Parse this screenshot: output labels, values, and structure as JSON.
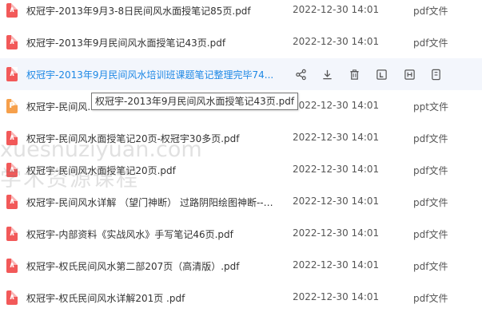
{
  "files": [
    {
      "name": "权冠宇-2013年9月3-8日民间风水面授笔记85页.pdf",
      "date": "2022-12-30 14:01",
      "type": "pdf文件",
      "icon": "pdf-file-icon",
      "hover": false
    },
    {
      "name": "权冠宇-2013年9月民间风水面授笔记43页.pdf",
      "date": "2022-12-30 14:01",
      "type": "pdf文件",
      "icon": "pdf-file-icon",
      "hover": false
    },
    {
      "name": "权冠宇-2013年9月民间风水培训班课题笔记整理完毕74...",
      "date": "",
      "type": "",
      "icon": "pdf-file-icon",
      "hover": true
    },
    {
      "name": "权冠宇-民间风...",
      "date": "2022-12-30 14:01",
      "type": "ppt文件",
      "icon": "ppt-file-icon",
      "hover": false
    },
    {
      "name": "权冠宇-民间风水面授笔记20页-权冠宇30多页.pdf",
      "date": "2022-12-30 14:01",
      "type": "pdf文件",
      "icon": "pdf-file-icon",
      "hover": false
    },
    {
      "name": "权冠宇-民间风水面授笔记20页.pdf",
      "date": "2022-12-30 14:01",
      "type": "pdf文件",
      "icon": "pdf-file-icon",
      "hover": false
    },
    {
      "name": "权冠宇-民间风水详解 （望门神断） 过路阴阳绘图神断---...",
      "date": "2022-12-30 14:01",
      "type": "pdf文件",
      "icon": "pdf-file-icon",
      "hover": false
    },
    {
      "name": "权冠宇-内部资料《实战风水》手写笔记46页.pdf",
      "date": "2022-12-30 14:01",
      "type": "pdf文件",
      "icon": "pdf-file-icon",
      "hover": false
    },
    {
      "name": "权冠宇-权氏民间风水第二部207页（高清版）.pdf",
      "date": "2022-12-30 14:01",
      "type": "pdf文件",
      "icon": "pdf-file-icon",
      "hover": false
    },
    {
      "name": "权冠宇-权氏民间风水详解201页 .pdf",
      "date": "2022-12-30 14:01",
      "type": "pdf文件",
      "icon": "pdf-file-icon",
      "hover": false
    }
  ],
  "row_actions": [
    {
      "icon": "share-icon"
    },
    {
      "icon": "download-icon"
    },
    {
      "icon": "delete-icon"
    },
    {
      "icon": "rename-icon"
    },
    {
      "icon": "move-icon"
    },
    {
      "icon": "more-icon"
    }
  ],
  "tooltip": "权冠宇-2013年9月民间风水面授笔记43页.pdf",
  "watermark": {
    "line1": "xuesnuziyuan.com",
    "line2": "学术资源课程"
  },
  "colors": {
    "accent": "#1e88e5",
    "pdf": "#f25959",
    "ppt": "#f6a04b",
    "hover_row": "#f3f6fc"
  }
}
